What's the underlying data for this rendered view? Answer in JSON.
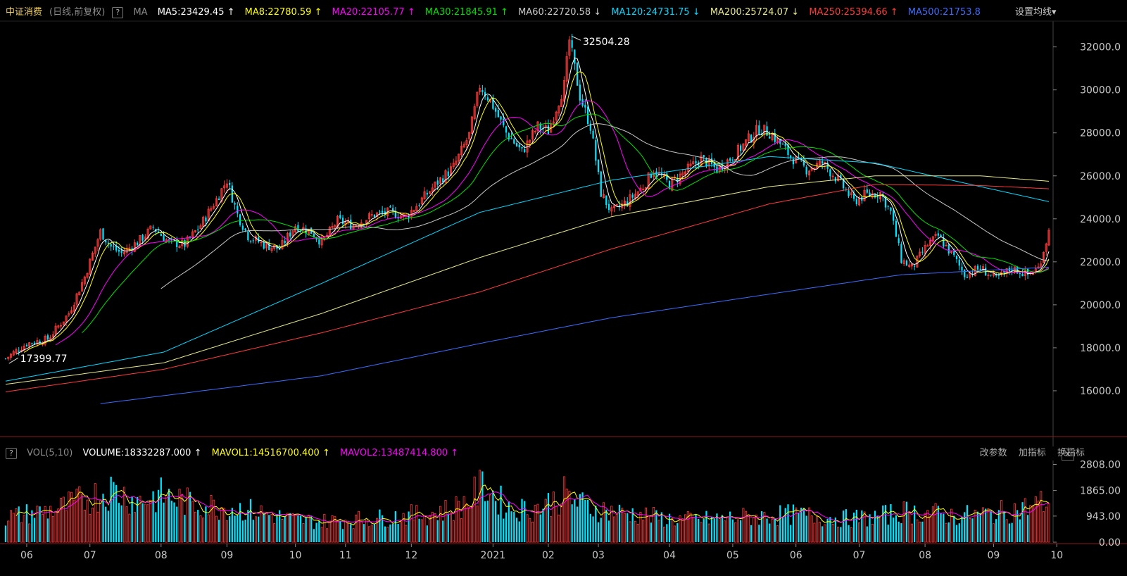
{
  "header": {
    "title": "中证消费",
    "subtitle": "(日线,前复权)",
    "help": "?",
    "ma_label": "MA",
    "indicators": [
      {
        "text": "MA5:23429.45 ↑",
        "color": "#ffffff"
      },
      {
        "text": "MA8:22780.59 ↑",
        "color": "#ffff00"
      },
      {
        "text": "MA20:22105.77 ↑",
        "color": "#ff00ff"
      },
      {
        "text": "MA30:21845.91 ↑",
        "color": "#00e000"
      },
      {
        "text": "MA60:22720.58 ↓",
        "color": "#c8c8c8"
      },
      {
        "text": "MA120:24731.75 ↓",
        "color": "#00d8ff"
      },
      {
        "text": "MA200:25724.07 ↓",
        "color": "#e8e88a"
      },
      {
        "text": "MA250:25394.66 ↑",
        "color": "#ff3a3a"
      },
      {
        "text": "MA500:21753.8",
        "color": "#3a6cff"
      }
    ],
    "settings_label": "设置均线",
    "settings_arrow": "▾"
  },
  "volume_header": {
    "help": "?",
    "label": "VOL(5,10)",
    "indicators": [
      {
        "text": "VOLUME:18332287.000 ↑",
        "color": "#ffffff"
      },
      {
        "text": "MAVOL1:14516700.400 ↑",
        "color": "#ffff00"
      },
      {
        "text": "MAVOL2:13487414.800 ↑",
        "color": "#ff00ff"
      }
    ],
    "buttons": [
      "改参数",
      "加指标",
      "换指标"
    ],
    "close": "✕"
  },
  "chart_data": [
    {
      "type": "candlestick",
      "price_ticks": [
        16000,
        18000,
        20000,
        22000,
        24000,
        26000,
        28000,
        30000,
        32000
      ],
      "price_tick_labels": [
        "16000.0",
        "18000.0",
        "20000.0",
        "22000.0",
        "24000.0",
        "26000.0",
        "28000.0",
        "30000.0",
        "32000.0"
      ],
      "y_range": [
        14000,
        33200
      ],
      "high_label": "32504.28",
      "high_value": 32504.28,
      "high_index": 214,
      "low_label": "17399.77",
      "low_value": 17399.77,
      "low_index": 1,
      "x_labels": [
        {
          "text": "06",
          "index": 8
        },
        {
          "text": "07",
          "index": 32
        },
        {
          "text": "08",
          "index": 59
        },
        {
          "text": "09",
          "index": 84
        },
        {
          "text": "10",
          "index": 110
        },
        {
          "text": "11",
          "index": 129
        },
        {
          "text": "12",
          "index": 154
        },
        {
          "text": "2021",
          "index": 185
        },
        {
          "text": "02",
          "index": 206
        },
        {
          "text": "03",
          "index": 225
        },
        {
          "text": "04",
          "index": 252
        },
        {
          "text": "05",
          "index": 276
        },
        {
          "text": "06",
          "index": 300
        },
        {
          "text": "07",
          "index": 324
        },
        {
          "text": "08",
          "index": 349
        },
        {
          "text": "09",
          "index": 375
        },
        {
          "text": "10",
          "index": 399
        }
      ],
      "bars": 397,
      "close_path": [
        [
          0,
          17500
        ],
        [
          8,
          18200
        ],
        [
          16,
          18400
        ],
        [
          24,
          19600
        ],
        [
          30,
          21300
        ],
        [
          36,
          23400
        ],
        [
          40,
          22700
        ],
        [
          44,
          22400
        ],
        [
          50,
          22900
        ],
        [
          56,
          23600
        ],
        [
          62,
          22900
        ],
        [
          68,
          22800
        ],
        [
          74,
          23700
        ],
        [
          80,
          24900
        ],
        [
          84,
          25800
        ],
        [
          88,
          24200
        ],
        [
          92,
          23200
        ],
        [
          98,
          22800
        ],
        [
          104,
          22600
        ],
        [
          110,
          23700
        ],
        [
          116,
          23400
        ],
        [
          120,
          22900
        ],
        [
          126,
          23900
        ],
        [
          132,
          23700
        ],
        [
          140,
          24200
        ],
        [
          146,
          24300
        ],
        [
          152,
          24100
        ],
        [
          158,
          24900
        ],
        [
          164,
          25700
        ],
        [
          170,
          26400
        ],
        [
          176,
          27900
        ],
        [
          180,
          30200
        ],
        [
          184,
          29500
        ],
        [
          190,
          28000
        ],
        [
          196,
          27100
        ],
        [
          202,
          28300
        ],
        [
          206,
          28100
        ],
        [
          212,
          30200
        ],
        [
          214,
          32300
        ],
        [
          218,
          29700
        ],
        [
          222,
          28300
        ],
        [
          226,
          25200
        ],
        [
          230,
          24300
        ],
        [
          236,
          24800
        ],
        [
          242,
          25500
        ],
        [
          246,
          26300
        ],
        [
          252,
          25600
        ],
        [
          258,
          26200
        ],
        [
          264,
          26800
        ],
        [
          270,
          26300
        ],
        [
          276,
          26900
        ],
        [
          282,
          27700
        ],
        [
          286,
          28200
        ],
        [
          290,
          28000
        ],
        [
          294,
          27500
        ],
        [
          298,
          26900
        ],
        [
          304,
          26300
        ],
        [
          310,
          26600
        ],
        [
          316,
          25800
        ],
        [
          322,
          24800
        ],
        [
          326,
          25100
        ],
        [
          332,
          25200
        ],
        [
          336,
          24300
        ],
        [
          340,
          22100
        ],
        [
          344,
          21700
        ],
        [
          350,
          22800
        ],
        [
          354,
          23200
        ],
        [
          360,
          22200
        ],
        [
          364,
          21400
        ],
        [
          370,
          21700
        ],
        [
          376,
          21200
        ],
        [
          382,
          21700
        ],
        [
          388,
          21400
        ],
        [
          392,
          21700
        ],
        [
          396,
          23400
        ]
      ],
      "series": [
        {
          "name": "MA5",
          "color": "#ffffff",
          "window": 5
        },
        {
          "name": "MA8",
          "color": "#ffff00",
          "window": 8
        },
        {
          "name": "MA20",
          "color": "#ff00ff",
          "window": 20
        },
        {
          "name": "MA30",
          "color": "#00e000",
          "window": 30
        },
        {
          "name": "MA60",
          "color": "#c8c8c8",
          "window": 60
        },
        {
          "name": "MA120",
          "color": "#00d8ff",
          "window": 120
        },
        {
          "name": "MA200",
          "color": "#e8e88a",
          "window": 200
        },
        {
          "name": "MA250",
          "color": "#ff3a3a",
          "window": 250
        },
        {
          "name": "MA500",
          "color": "#3a6cff",
          "window": 500
        }
      ],
      "long_ma_paths": {
        "MA120": [
          [
            0,
            16450
          ],
          [
            60,
            17800
          ],
          [
            120,
            21000
          ],
          [
            180,
            24300
          ],
          [
            230,
            25800
          ],
          [
            290,
            26900
          ],
          [
            330,
            26600
          ],
          [
            370,
            25500
          ],
          [
            396,
            24800
          ]
        ],
        "MA200": [
          [
            0,
            16300
          ],
          [
            60,
            17300
          ],
          [
            120,
            19600
          ],
          [
            180,
            22200
          ],
          [
            230,
            24100
          ],
          [
            290,
            25500
          ],
          [
            330,
            26000
          ],
          [
            370,
            26000
          ],
          [
            396,
            25750
          ]
        ],
        "MA250": [
          [
            0,
            15950
          ],
          [
            60,
            17000
          ],
          [
            120,
            18700
          ],
          [
            180,
            20600
          ],
          [
            230,
            22600
          ],
          [
            290,
            24700
          ],
          [
            330,
            25600
          ],
          [
            370,
            25550
          ],
          [
            396,
            25400
          ]
        ],
        "MA500": [
          [
            36,
            15400
          ],
          [
            120,
            16700
          ],
          [
            180,
            18200
          ],
          [
            230,
            19400
          ],
          [
            290,
            20500
          ],
          [
            340,
            21400
          ],
          [
            396,
            21750
          ]
        ]
      },
      "up_color": "#ff3a3a",
      "down_color": "#00e5ff"
    },
    {
      "type": "bar",
      "volume_ticks": [
        0,
        943,
        1865,
        2808
      ],
      "volume_tick_labels": [
        "0.00",
        "943.00",
        "1865.00",
        "2808.00"
      ],
      "y_range": [
        0,
        3100
      ],
      "volume_path": [
        [
          0,
          900
        ],
        [
          20,
          1200
        ],
        [
          32,
          1600
        ],
        [
          40,
          1900
        ],
        [
          50,
          1500
        ],
        [
          60,
          1700
        ],
        [
          70,
          1400
        ],
        [
          80,
          1300
        ],
        [
          90,
          1200
        ],
        [
          100,
          1000
        ],
        [
          110,
          800
        ],
        [
          120,
          750
        ],
        [
          130,
          800
        ],
        [
          140,
          850
        ],
        [
          150,
          950
        ],
        [
          160,
          1000
        ],
        [
          170,
          1200
        ],
        [
          176,
          1500
        ],
        [
          182,
          2100
        ],
        [
          186,
          1600
        ],
        [
          192,
          1200
        ],
        [
          200,
          1200
        ],
        [
          206,
          1400
        ],
        [
          212,
          1700
        ],
        [
          220,
          1300
        ],
        [
          230,
          1100
        ],
        [
          240,
          1000
        ],
        [
          250,
          850
        ],
        [
          260,
          800
        ],
        [
          270,
          850
        ],
        [
          280,
          900
        ],
        [
          290,
          950
        ],
        [
          300,
          1000
        ],
        [
          310,
          900
        ],
        [
          320,
          850
        ],
        [
          330,
          900
        ],
        [
          340,
          1100
        ],
        [
          350,
          1050
        ],
        [
          360,
          950
        ],
        [
          370,
          1000
        ],
        [
          380,
          1100
        ],
        [
          390,
          1300
        ],
        [
          396,
          1500
        ]
      ],
      "mavol1_color": "#ffff00",
      "mavol2_color": "#ff00ff"
    }
  ]
}
